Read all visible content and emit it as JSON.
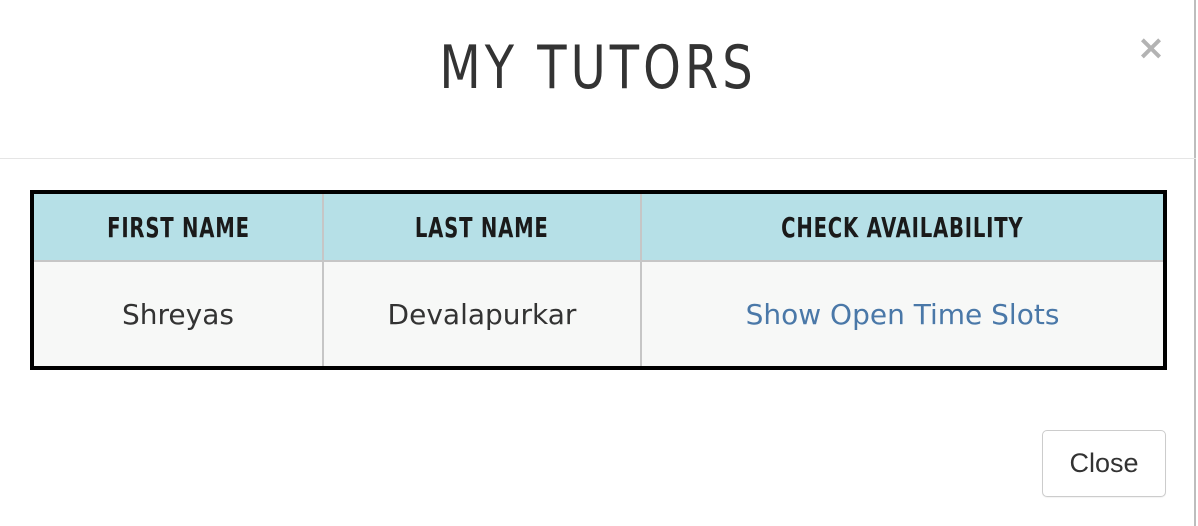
{
  "modal": {
    "title": "MY TUTORS",
    "close_icon": "×"
  },
  "table": {
    "headers": [
      "FIRST NAME",
      "LAST NAME",
      "CHECK AVAILABILITY"
    ],
    "rows": [
      {
        "first_name": "Shreyas",
        "last_name": "Devalapurkar",
        "availability_link": "Show Open Time Slots"
      }
    ]
  },
  "footer": {
    "close_label": "Close"
  },
  "colors": {
    "header_bg": "#b6e0e7",
    "link": "#4a78a8",
    "table_border": "#000000"
  }
}
